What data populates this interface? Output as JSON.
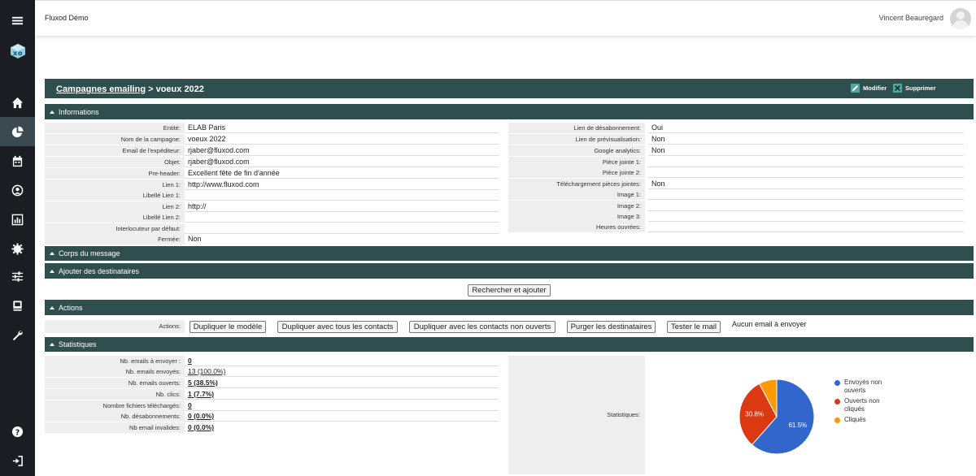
{
  "header": {
    "app_name": "Fluxod Démo",
    "user_name": "Vincent Beauregard"
  },
  "sidebar": {
    "items": [
      {
        "icon": "menu-icon"
      },
      {
        "icon": "logo-icon"
      },
      {
        "icon": "home-icon"
      },
      {
        "icon": "pie-chart-icon"
      },
      {
        "icon": "calendar-icon"
      },
      {
        "icon": "user-circle-icon"
      },
      {
        "icon": "bar-chart-icon"
      },
      {
        "icon": "gear-icon"
      },
      {
        "icon": "sliders-icon"
      },
      {
        "icon": "book-icon"
      },
      {
        "icon": "wrench-icon"
      },
      {
        "icon": "help-icon"
      },
      {
        "icon": "logout-icon"
      }
    ]
  },
  "title": {
    "link": "Campagnes emailing",
    "separator": " > ",
    "current": "voeux 2022",
    "modify_label": "Modifier",
    "delete_label": "Supprimer"
  },
  "sections": {
    "informations": "Informations",
    "corps": "Corps du message",
    "destinataires": "Ajouter des destinataires",
    "actions": "Actions",
    "statistiques": "Statistiques"
  },
  "info_left": [
    {
      "label": "Entité:",
      "value": "ELAB Paris"
    },
    {
      "label": "Nom de la campagne:",
      "value": "voeux 2022"
    },
    {
      "label": "Email de l'expéditeur:",
      "value": "rjaber@fluxod.com"
    },
    {
      "label": "Objet:",
      "value": "rjaber@fluxod.com"
    },
    {
      "label": "Pre-header:",
      "value": "Excellent fête de fin d'année"
    },
    {
      "label": "Lien 1:",
      "value": "http://www.fluxod.com"
    },
    {
      "label": "Libellé Lien 1:",
      "value": ""
    },
    {
      "label": "Lien 2:",
      "value": "http://"
    },
    {
      "label": "Libellé Lien 2:",
      "value": ""
    },
    {
      "label": "Interlocuteur par défaut:",
      "value": ""
    },
    {
      "label": "Fermée:",
      "value": "Non"
    }
  ],
  "info_right": [
    {
      "label": "Lien de désabonnement:",
      "value": "Oui"
    },
    {
      "label": "Lien de prévisualisation:",
      "value": "Non"
    },
    {
      "label": "Google analytics:",
      "value": "Non"
    },
    {
      "label": "Pièce jointe 1:",
      "value": ""
    },
    {
      "label": "Pièce jointe 2:",
      "value": ""
    },
    {
      "label": "Téléchargement pièces jointes:",
      "value": "Non"
    },
    {
      "label": "Image 1:",
      "value": ""
    },
    {
      "label": "Image 2:",
      "value": ""
    },
    {
      "label": "Image 3:",
      "value": ""
    },
    {
      "label": "Heures ouvrées:",
      "value": ""
    }
  ],
  "search_button": "Rechercher et ajouter",
  "actions": {
    "label": "Actions:",
    "buttons": [
      "Dupliquer le modèle",
      "Dupliquer avec tous les contacts",
      "Dupliquer avec les contacts non ouverts",
      "Purger les destinataires",
      "Tester le mail"
    ],
    "status": "Aucun email à envoyer"
  },
  "stats": [
    {
      "label": "Nb. emails à envoyer :",
      "value": "0"
    },
    {
      "label": "Nb. emails envoyés:",
      "value": "13 (100.0%)"
    },
    {
      "label": "Nb. emails ouverts:",
      "value": "5 (38.5%)"
    },
    {
      "label": "Nb. clics:",
      "value": "1 (7.7%)"
    },
    {
      "label": "Nombre fichiers téléchargés:",
      "value": "0"
    },
    {
      "label": "Nb. désabonnements:",
      "value": "0 (0.0%)"
    },
    {
      "label": "Nb email invalides:",
      "value": "0 (0.0%)"
    }
  ],
  "stats_chart_label": "Statistiques:",
  "chart_data": {
    "type": "pie",
    "slices": [
      {
        "name": "Envoyés non ouverts",
        "value": 61.5,
        "label": "61.5%",
        "color": "#3366cc"
      },
      {
        "name": "Ouverts non cliqués",
        "value": 30.8,
        "label": "30.8%",
        "color": "#dc3912"
      },
      {
        "name": "Cliqués",
        "value": 7.7,
        "label": "",
        "color": "#ff9900"
      }
    ],
    "legend": "right"
  }
}
